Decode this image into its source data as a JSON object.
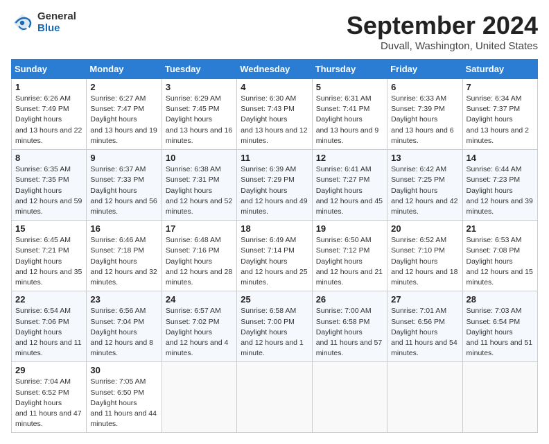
{
  "header": {
    "logo_line1": "General",
    "logo_line2": "Blue",
    "month": "September 2024",
    "location": "Duvall, Washington, United States"
  },
  "weekdays": [
    "Sunday",
    "Monday",
    "Tuesday",
    "Wednesday",
    "Thursday",
    "Friday",
    "Saturday"
  ],
  "weeks": [
    [
      {
        "day": "1",
        "rise": "6:26 AM",
        "set": "7:49 PM",
        "daylight": "13 hours and 22 minutes."
      },
      {
        "day": "2",
        "rise": "6:27 AM",
        "set": "7:47 PM",
        "daylight": "13 hours and 19 minutes."
      },
      {
        "day": "3",
        "rise": "6:29 AM",
        "set": "7:45 PM",
        "daylight": "13 hours and 16 minutes."
      },
      {
        "day": "4",
        "rise": "6:30 AM",
        "set": "7:43 PM",
        "daylight": "13 hours and 12 minutes."
      },
      {
        "day": "5",
        "rise": "6:31 AM",
        "set": "7:41 PM",
        "daylight": "13 hours and 9 minutes."
      },
      {
        "day": "6",
        "rise": "6:33 AM",
        "set": "7:39 PM",
        "daylight": "13 hours and 6 minutes."
      },
      {
        "day": "7",
        "rise": "6:34 AM",
        "set": "7:37 PM",
        "daylight": "13 hours and 2 minutes."
      }
    ],
    [
      {
        "day": "8",
        "rise": "6:35 AM",
        "set": "7:35 PM",
        "daylight": "12 hours and 59 minutes."
      },
      {
        "day": "9",
        "rise": "6:37 AM",
        "set": "7:33 PM",
        "daylight": "12 hours and 56 minutes."
      },
      {
        "day": "10",
        "rise": "6:38 AM",
        "set": "7:31 PM",
        "daylight": "12 hours and 52 minutes."
      },
      {
        "day": "11",
        "rise": "6:39 AM",
        "set": "7:29 PM",
        "daylight": "12 hours and 49 minutes."
      },
      {
        "day": "12",
        "rise": "6:41 AM",
        "set": "7:27 PM",
        "daylight": "12 hours and 45 minutes."
      },
      {
        "day": "13",
        "rise": "6:42 AM",
        "set": "7:25 PM",
        "daylight": "12 hours and 42 minutes."
      },
      {
        "day": "14",
        "rise": "6:44 AM",
        "set": "7:23 PM",
        "daylight": "12 hours and 39 minutes."
      }
    ],
    [
      {
        "day": "15",
        "rise": "6:45 AM",
        "set": "7:21 PM",
        "daylight": "12 hours and 35 minutes."
      },
      {
        "day": "16",
        "rise": "6:46 AM",
        "set": "7:18 PM",
        "daylight": "12 hours and 32 minutes."
      },
      {
        "day": "17",
        "rise": "6:48 AM",
        "set": "7:16 PM",
        "daylight": "12 hours and 28 minutes."
      },
      {
        "day": "18",
        "rise": "6:49 AM",
        "set": "7:14 PM",
        "daylight": "12 hours and 25 minutes."
      },
      {
        "day": "19",
        "rise": "6:50 AM",
        "set": "7:12 PM",
        "daylight": "12 hours and 21 minutes."
      },
      {
        "day": "20",
        "rise": "6:52 AM",
        "set": "7:10 PM",
        "daylight": "12 hours and 18 minutes."
      },
      {
        "day": "21",
        "rise": "6:53 AM",
        "set": "7:08 PM",
        "daylight": "12 hours and 15 minutes."
      }
    ],
    [
      {
        "day": "22",
        "rise": "6:54 AM",
        "set": "7:06 PM",
        "daylight": "12 hours and 11 minutes."
      },
      {
        "day": "23",
        "rise": "6:56 AM",
        "set": "7:04 PM",
        "daylight": "12 hours and 8 minutes."
      },
      {
        "day": "24",
        "rise": "6:57 AM",
        "set": "7:02 PM",
        "daylight": "12 hours and 4 minutes."
      },
      {
        "day": "25",
        "rise": "6:58 AM",
        "set": "7:00 PM",
        "daylight": "12 hours and 1 minute."
      },
      {
        "day": "26",
        "rise": "7:00 AM",
        "set": "6:58 PM",
        "daylight": "11 hours and 57 minutes."
      },
      {
        "day": "27",
        "rise": "7:01 AM",
        "set": "6:56 PM",
        "daylight": "11 hours and 54 minutes."
      },
      {
        "day": "28",
        "rise": "7:03 AM",
        "set": "6:54 PM",
        "daylight": "11 hours and 51 minutes."
      }
    ],
    [
      {
        "day": "29",
        "rise": "7:04 AM",
        "set": "6:52 PM",
        "daylight": "11 hours and 47 minutes."
      },
      {
        "day": "30",
        "rise": "7:05 AM",
        "set": "6:50 PM",
        "daylight": "11 hours and 44 minutes."
      },
      null,
      null,
      null,
      null,
      null
    ]
  ]
}
